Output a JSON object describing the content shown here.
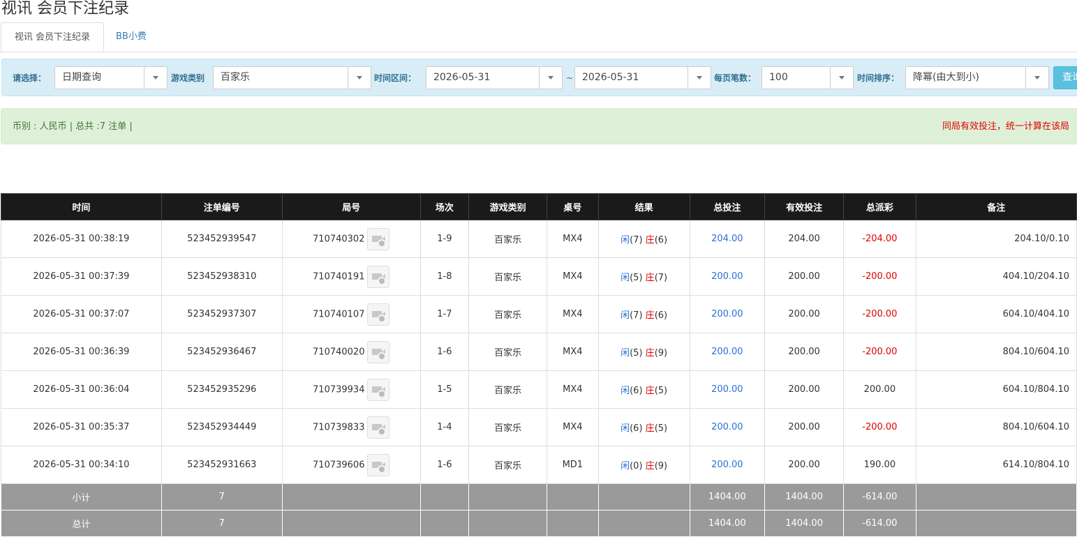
{
  "page": {
    "title": "视讯 会员下注纪录"
  },
  "tabs": [
    {
      "label": "视讯 会员下注纪录",
      "active": true
    },
    {
      "label": "BB小费",
      "active": false
    }
  ],
  "filters": {
    "select_label": "请选择：",
    "select_value": "日期查询",
    "game_type_label": "游戏类别",
    "game_type_value": "百家乐",
    "time_range_label": "时间区间：",
    "date_from": "2026-05-31",
    "tilde": "~",
    "date_to": "2026-05-31",
    "per_page_label": "每页笔数：",
    "per_page_value": "100",
    "sort_label": "时间排序：",
    "sort_value": "降幂(由大到小)",
    "query_button": "查询"
  },
  "summary": {
    "left": "币别 : 人民币 | 总共 :7 注单 |",
    "right": "同局有效投注，统一计算在该局"
  },
  "table": {
    "headers": [
      "时间",
      "注单编号",
      "局号",
      "场次",
      "游戏类别",
      "桌号",
      "结果",
      "总投注",
      "有效投注",
      "总派彩",
      "备注"
    ],
    "rows": [
      {
        "time": "2026-05-31 00:38:19",
        "order_no": "523452939547",
        "round_no": "710740302",
        "session": "1-9",
        "game": "百家乐",
        "table_no": "MX4",
        "xian_label": "闲",
        "xian_val": "(7)",
        "zhuang_label": "庄",
        "zhuang_val": "(6)",
        "total_bet": "204.00",
        "valid_bet": "204.00",
        "payout": "-204.00",
        "payout_negative": true,
        "note": "204.10/0.10"
      },
      {
        "time": "2026-05-31 00:37:39",
        "order_no": "523452938310",
        "round_no": "710740191",
        "session": "1-8",
        "game": "百家乐",
        "table_no": "MX4",
        "xian_label": "闲",
        "xian_val": "(5)",
        "zhuang_label": "庄",
        "zhuang_val": "(7)",
        "total_bet": "200.00",
        "valid_bet": "200.00",
        "payout": "-200.00",
        "payout_negative": true,
        "note": "404.10/204.10"
      },
      {
        "time": "2026-05-31 00:37:07",
        "order_no": "523452937307",
        "round_no": "710740107",
        "session": "1-7",
        "game": "百家乐",
        "table_no": "MX4",
        "xian_label": "闲",
        "xian_val": "(7)",
        "zhuang_label": "庄",
        "zhuang_val": "(6)",
        "total_bet": "200.00",
        "valid_bet": "200.00",
        "payout": "-200.00",
        "payout_negative": true,
        "note": "604.10/404.10"
      },
      {
        "time": "2026-05-31 00:36:39",
        "order_no": "523452936467",
        "round_no": "710740020",
        "session": "1-6",
        "game": "百家乐",
        "table_no": "MX4",
        "xian_label": "闲",
        "xian_val": "(5)",
        "zhuang_label": "庄",
        "zhuang_val": "(9)",
        "total_bet": "200.00",
        "valid_bet": "200.00",
        "payout": "-200.00",
        "payout_negative": true,
        "note": "804.10/604.10"
      },
      {
        "time": "2026-05-31 00:36:04",
        "order_no": "523452935296",
        "round_no": "710739934",
        "session": "1-5",
        "game": "百家乐",
        "table_no": "MX4",
        "xian_label": "闲",
        "xian_val": "(6)",
        "zhuang_label": "庄",
        "zhuang_val": "(5)",
        "total_bet": "200.00",
        "valid_bet": "200.00",
        "payout": "200.00",
        "payout_negative": false,
        "note": "604.10/804.10"
      },
      {
        "time": "2026-05-31 00:35:37",
        "order_no": "523452934449",
        "round_no": "710739833",
        "session": "1-4",
        "game": "百家乐",
        "table_no": "MX4",
        "xian_label": "闲",
        "xian_val": "(6)",
        "zhuang_label": "庄",
        "zhuang_val": "(5)",
        "total_bet": "200.00",
        "valid_bet": "200.00",
        "payout": "-200.00",
        "payout_negative": true,
        "note": "804.10/604.10"
      },
      {
        "time": "2026-05-31 00:34:10",
        "order_no": "523452931663",
        "round_no": "710739606",
        "session": "1-6",
        "game": "百家乐",
        "table_no": "MD1",
        "xian_label": "闲",
        "xian_val": "(0)",
        "zhuang_label": "庄",
        "zhuang_val": "(9)",
        "total_bet": "200.00",
        "valid_bet": "200.00",
        "payout": "190.00",
        "payout_negative": false,
        "note": "614.10/804.10"
      }
    ],
    "subtotal": {
      "label": "小计",
      "count": "7",
      "total_bet": "1404.00",
      "valid_bet": "1404.00",
      "payout": "-614.00"
    },
    "total": {
      "label": "总计",
      "count": "7",
      "total_bet": "1404.00",
      "valid_bet": "1404.00",
      "payout": "-614.00"
    }
  },
  "colors": {
    "header_bg": "#1a1a1a",
    "footer_bg": "#9a9a9a",
    "positive_blue": "#2a6fd6",
    "negative_red": "#e00000",
    "filter_bg": "#d9edf7",
    "summary_bg": "#dff0d8"
  },
  "icons": {
    "round_video": "video-replay-icon"
  }
}
